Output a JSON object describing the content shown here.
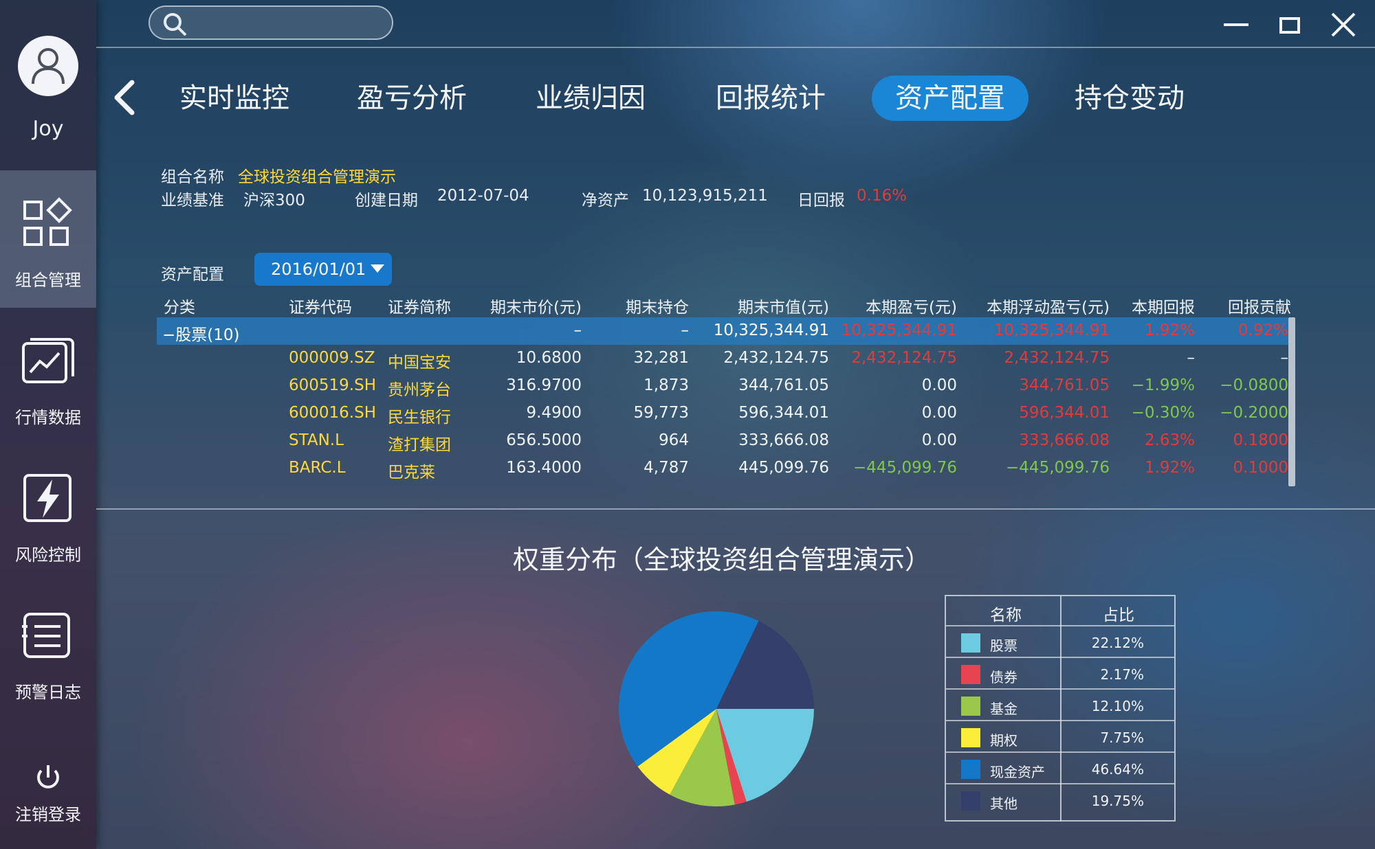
{
  "user": {
    "name": "Joy"
  },
  "sidebar": {
    "items": [
      {
        "label": "组合管理",
        "icon": "portfolio-grid-icon"
      },
      {
        "label": "行情数据",
        "icon": "market-chart-icon"
      },
      {
        "label": "风险控制",
        "icon": "lightning-icon"
      },
      {
        "label": "预警日志",
        "icon": "log-list-icon"
      }
    ],
    "logout": {
      "label": "注销登录",
      "icon": "power-icon"
    }
  },
  "search": {
    "placeholder": ""
  },
  "tabs": [
    "实时监控",
    "盈亏分析",
    "业绩归因",
    "回报统计",
    "资产配置",
    "持仓变动"
  ],
  "active_tab": "资产配置",
  "info": {
    "portfolio_label": "组合名称",
    "portfolio_name": "全球投资组合管理演示",
    "benchmark_label": "业绩基准",
    "benchmark": "沪深300",
    "created_label": "创建日期",
    "created": "2012-07-04",
    "nav_label": "净资产",
    "nav": "10,123,915,211",
    "daily_label": "日回报",
    "daily": "0.16%"
  },
  "allocation": {
    "label": "资产配置",
    "date": "2016/01/01"
  },
  "table": {
    "headers": [
      "分类",
      "证券代码",
      "证券简称",
      "期末市价(元)",
      "期末持仓",
      "期末市值(元)",
      "本期盈亏(元)",
      "本期浮动盈亏(元)",
      "本期回报",
      "回报贡献"
    ],
    "group": {
      "category": "−股票(10)",
      "price": "–",
      "position": "–",
      "value": "10,325,344.91",
      "pnl": "10,325,344.91",
      "float_pnl": "10,325,344.91",
      "return": "1.92%",
      "contribution": "0.92%"
    },
    "rows": [
      {
        "code": "000009.SZ",
        "name": "中国宝安",
        "price": "10.6800",
        "position": "32,281",
        "value": "2,432,124.75",
        "pnl": "2,432,124.75",
        "float_pnl": "2,432,124.75",
        "return": "–",
        "contribution": "–"
      },
      {
        "code": "600519.SH",
        "name": "贵州茅台",
        "price": "316.9700",
        "position": "1,873",
        "value": "344,761.05",
        "pnl": "0.00",
        "float_pnl": "344,761.05",
        "return": "−1.99%",
        "contribution": "−0.0800"
      },
      {
        "code": "600016.SH",
        "name": "民生银行",
        "price": "9.4900",
        "position": "59,773",
        "value": "596,344.01",
        "pnl": "0.00",
        "float_pnl": "596,344.01",
        "return": "−0.30%",
        "contribution": "−0.2000"
      },
      {
        "code": "STAN.L",
        "name": "渣打集团",
        "price": "656.5000",
        "position": "964",
        "value": "333,666.08",
        "pnl": "0.00",
        "float_pnl": "333,666.08",
        "return": "2.63%",
        "contribution": "0.1800"
      },
      {
        "code": "BARC.L",
        "name": "巴克莱",
        "price": "163.4000",
        "position": "4,787",
        "value": "445,099.76",
        "pnl": "−445,099.76",
        "float_pnl": "−445,099.76",
        "return": "1.92%",
        "contribution": "0.1000"
      }
    ]
  },
  "colors": {
    "accent": "#1b86d6",
    "positive": "#e23b3b",
    "negative": "#7ec84a",
    "code": "#ffd83a"
  },
  "chart_data": {
    "type": "pie",
    "title": "权重分布（全球投资组合管理演示）",
    "legend_headers": [
      "名称",
      "占比"
    ],
    "slices": [
      {
        "name": "股票",
        "value": 22.12,
        "label": "22.12%",
        "color": "#6ccbe0"
      },
      {
        "name": "债券",
        "value": 2.17,
        "label": "2.17%",
        "color": "#e84350"
      },
      {
        "name": "基金",
        "value": 12.1,
        "label": "12.10%",
        "color": "#9ac84a"
      },
      {
        "name": "期权",
        "value": 7.75,
        "label": "7.75%",
        "color": "#fbee3a"
      },
      {
        "name": "现金资产",
        "value": 46.64,
        "label": "46.64%",
        "color": "#1478c8"
      },
      {
        "name": "其他",
        "value": 19.75,
        "label": "19.75%",
        "color": "#343f6c"
      }
    ],
    "legend_position": "right"
  }
}
